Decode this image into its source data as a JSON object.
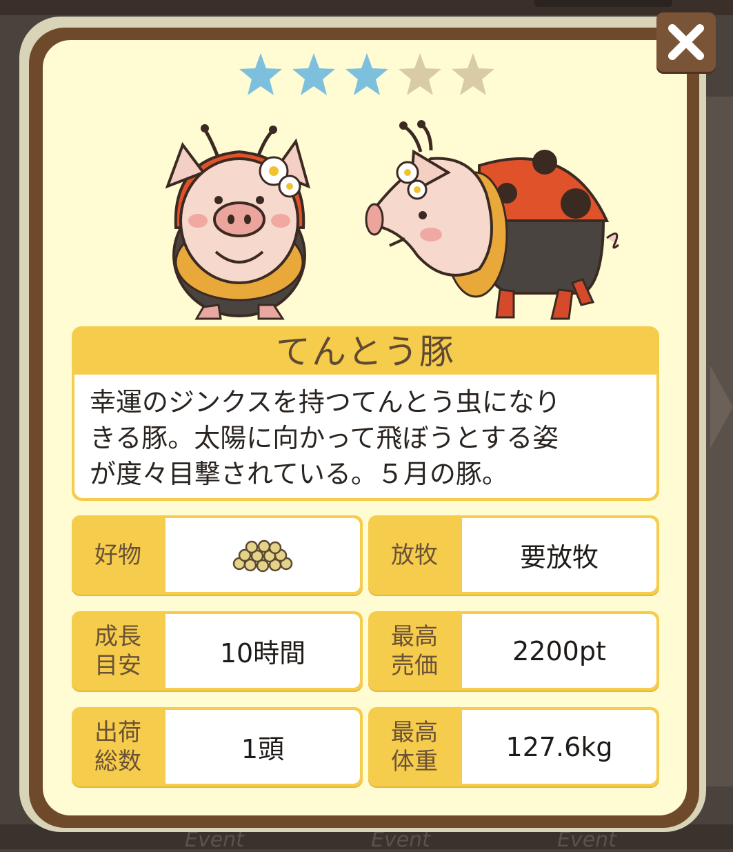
{
  "background": {
    "event_labels": [
      "Event",
      "Event",
      "Event"
    ]
  },
  "close_button": {
    "icon": "close-icon"
  },
  "rating": {
    "value": 3,
    "max": 5,
    "filled_color": "#7cc0de",
    "empty_color": "#d9cca4"
  },
  "pig": {
    "name": "てんとう豚",
    "description_lines": [
      "幸運のジンクスを持つてんとう虫になり",
      "きる豚。太陽に向かって飛ぼうとする姿",
      "が度々目撃されている。５月の豚。"
    ]
  },
  "stats": {
    "favorite": {
      "label": "好物",
      "icon": "feed-pellets-icon"
    },
    "grazing": {
      "label": "放牧",
      "value": "要放牧"
    },
    "growth": {
      "label_lines": [
        "成長",
        "目安"
      ],
      "value": "10時間"
    },
    "max_price": {
      "label_lines": [
        "最高",
        "売価"
      ],
      "value": "2200pt"
    },
    "shipped": {
      "label_lines": [
        "出荷",
        "総数"
      ],
      "value": "1頭"
    },
    "max_weight": {
      "label_lines": [
        "最高",
        "体重"
      ],
      "value": "127.6kg"
    }
  },
  "colors": {
    "panel_brown": "#6e4a2b",
    "panel_cream": "#fffbd3",
    "label_yellow": "#f6cc4c",
    "ladybug_red": "#e0532a"
  }
}
